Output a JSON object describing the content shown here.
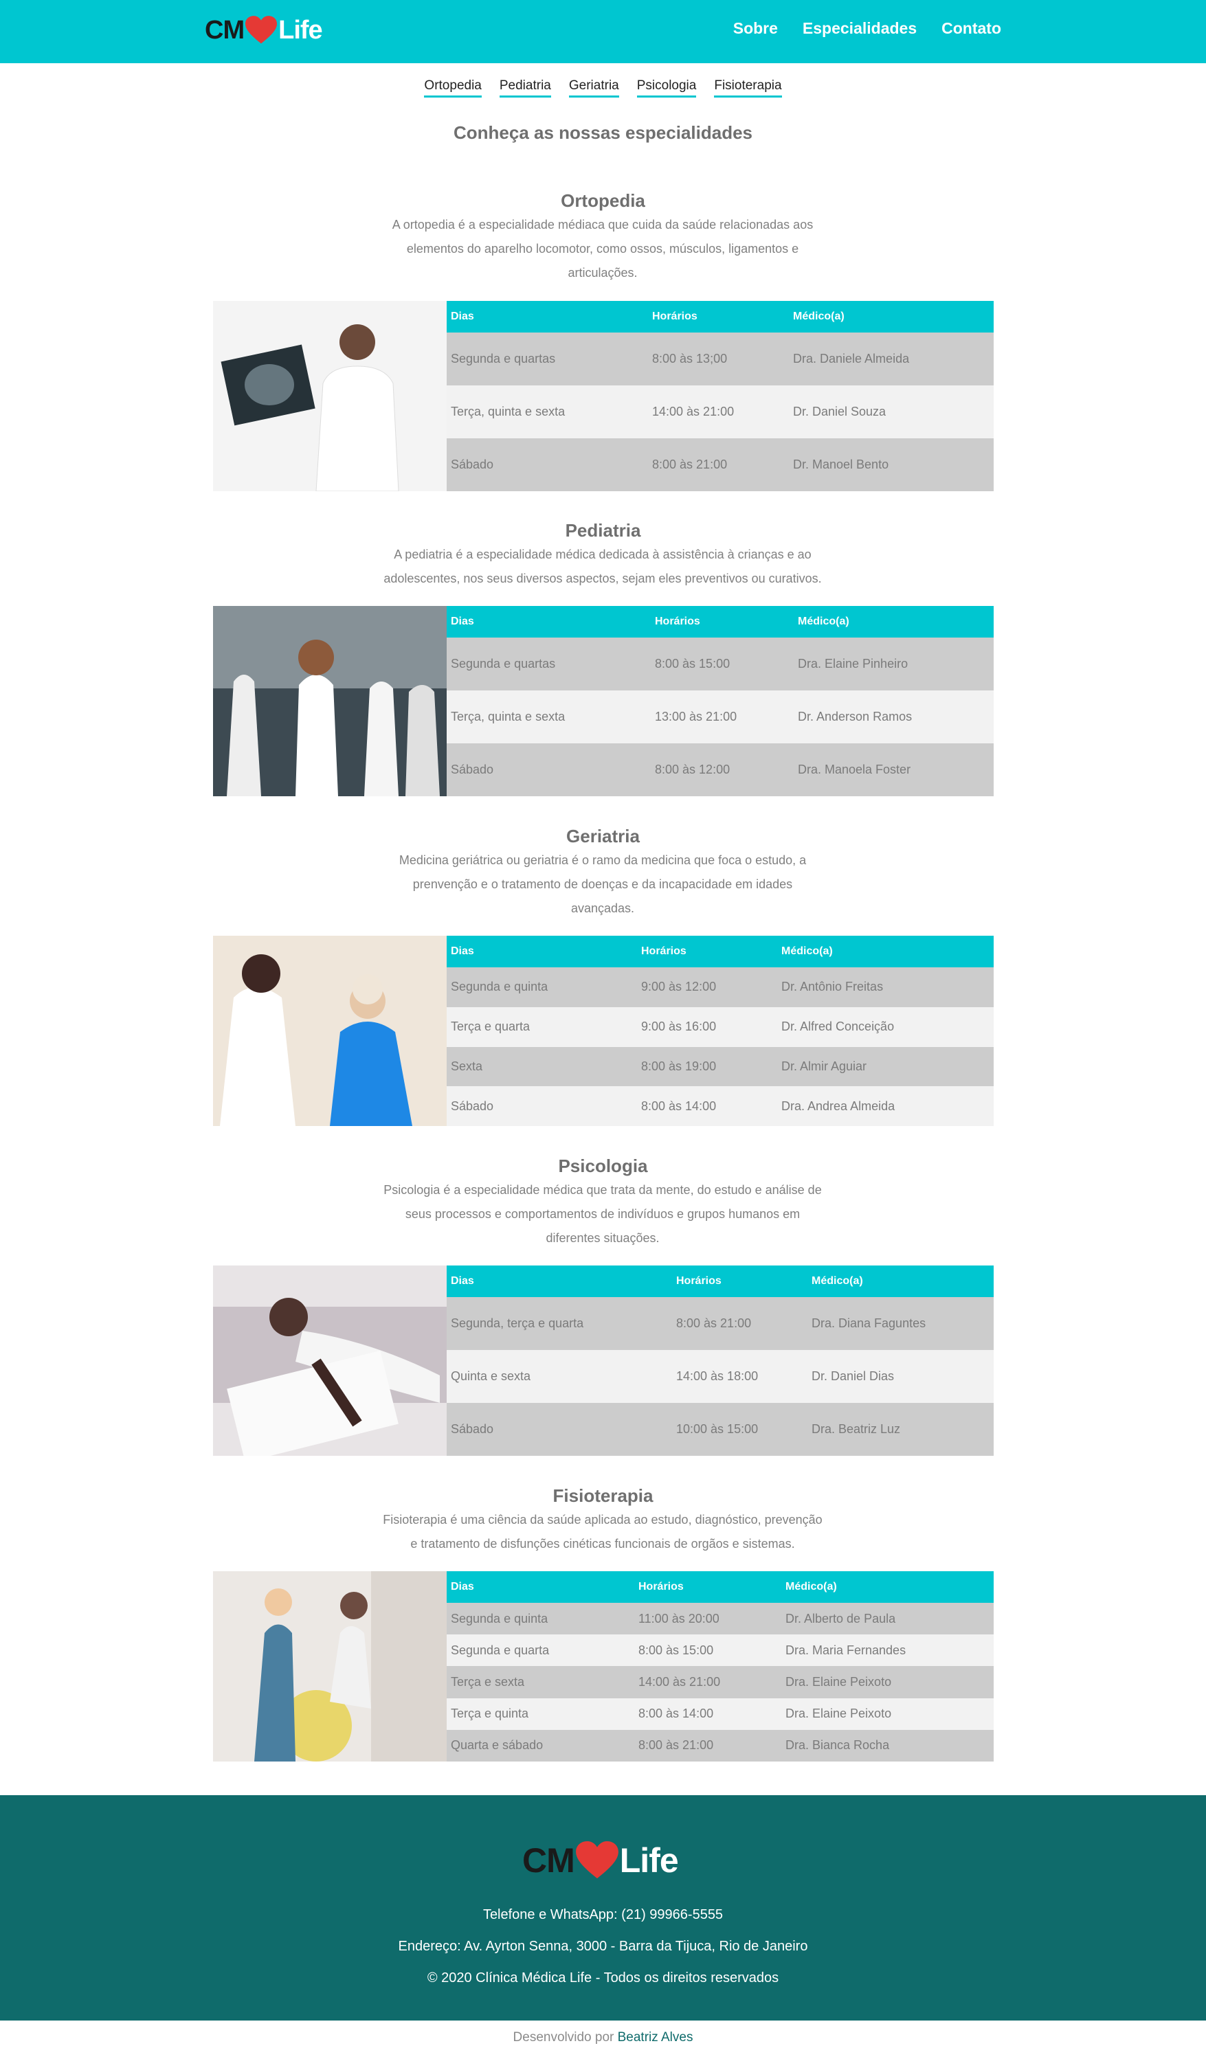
{
  "header": {
    "logo_prefix": "CM",
    "logo_suffix": "Life",
    "nav": [
      "Sobre",
      "Especialidades",
      "Contato"
    ]
  },
  "anchors": [
    "Ortopedia",
    "Pediatria",
    "Geriatria",
    "Psicologia",
    "Fisioterapia"
  ],
  "page_title": "Conheça as nossas especialidades",
  "table_headers": [
    "Dias",
    "Horários",
    "Médico(a)"
  ],
  "sections": [
    {
      "title": "Ortopedia",
      "desc": [
        "A ortopedia é a especialidade médiaca que cuida da saúde relacionadas aos",
        "elementos do aparelho locomotor, como ossos, músculos, ligamentos e",
        "articulações."
      ],
      "rows": [
        [
          "Segunda e quartas",
          "8:00 às 13;00",
          "Dra. Daniele Almeida"
        ],
        [
          "Terça, quinta e sexta",
          "14:00 às 21:00",
          "Dr. Daniel Souza"
        ],
        [
          "Sábado",
          "8:00 às 21:00",
          "Dr. Manoel Bento"
        ]
      ]
    },
    {
      "title": "Pediatria",
      "desc": [
        "A pediatria é a especialidade médica dedicada à assistência à crianças e ao",
        "adolescentes, nos seus diversos aspectos, sejam eles preventivos ou curativos."
      ],
      "rows": [
        [
          "Segunda e quartas",
          "8:00 às 15:00",
          "Dra. Elaine Pinheiro"
        ],
        [
          "Terça, quinta e sexta",
          "13:00 às 21:00",
          "Dr. Anderson Ramos"
        ],
        [
          "Sábado",
          "8:00 às 12:00",
          "Dra. Manoela Foster"
        ]
      ]
    },
    {
      "title": "Geriatria",
      "desc": [
        "Medicina geriátrica ou geriatria é o ramo da medicina que foca o estudo, a",
        "prenvenção e o tratamento de doenças e da incapacidade em idades",
        "avançadas."
      ],
      "rows": [
        [
          "Segunda e quinta",
          "9:00 às 12:00",
          "Dr. Antônio Freitas"
        ],
        [
          "Terça e quarta",
          "9:00 às 16:00",
          "Dr. Alfred Conceição"
        ],
        [
          "Sexta",
          "8:00 às 19:00",
          "Dr. Almir Aguiar"
        ],
        [
          "Sábado",
          "8:00 às 14:00",
          "Dra. Andrea Almeida"
        ]
      ]
    },
    {
      "title": "Psicologia",
      "desc": [
        "Psicologia é a especialidade médica que trata da mente, do estudo e análise de",
        "seus processos e comportamentos de indivíduos e grupos humanos em",
        "diferentes situações."
      ],
      "rows": [
        [
          "Segunda, terça e quarta",
          "8:00 às 21:00",
          "Dra. Diana Faguntes"
        ],
        [
          "Quinta e sexta",
          "14:00 às 18:00",
          "Dr. Daniel Dias"
        ],
        [
          "Sábado",
          "10:00 às 15:00",
          "Dra. Beatriz Luz"
        ]
      ]
    },
    {
      "title": "Fisioterapia",
      "desc": [
        "Fisioterapia é uma ciência da saúde aplicada ao estudo, diagnóstico, prevenção",
        "e tratamento de disfunções cinéticas funcionais de orgãos e sistemas."
      ],
      "rows": [
        [
          "Segunda e quinta",
          "11:00 às 20:00",
          "Dr. Alberto de Paula"
        ],
        [
          "Segunda e quarta",
          "8:00 às 15:00",
          "Dra. Maria Fernandes"
        ],
        [
          "Terça e sexta",
          "14:00 às 21:00",
          "Dra. Elaine Peixoto"
        ],
        [
          "Terça e quinta",
          "8:00 às 14:00",
          "Dra. Elaine Peixoto"
        ],
        [
          "Quarta e sábado",
          "8:00 às 21:00",
          "Dra. Bianca Rocha"
        ]
      ]
    }
  ],
  "footer": {
    "phone": "Telefone e WhatsApp: (21) 99966-5555",
    "address": "Endereço: Av. Ayrton Senna, 3000 - Barra da Tijuca, Rio de Janeiro",
    "copyright": "© 2020 Clínica Médica Life - Todos os direitos reservados"
  },
  "credit": {
    "prefix": "Desenvolvido por",
    "author": "Beatriz Alves"
  },
  "colors": {
    "accent": "#00c6d0",
    "footer_bg": "#0f6b6b",
    "heart": "#e53935",
    "row_dark": "#cccccc",
    "row_light": "#f2f2f2"
  }
}
